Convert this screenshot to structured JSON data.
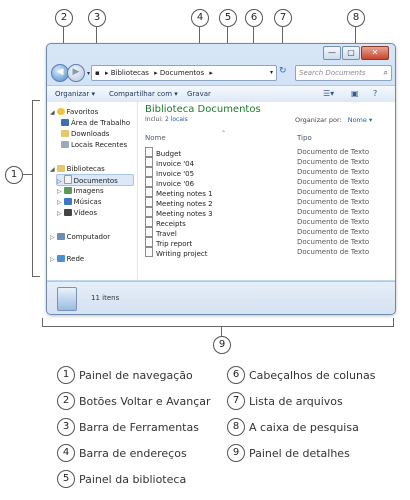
{
  "window": {
    "controls": {
      "minimize": "—",
      "maximize": "▢",
      "close": "✕"
    },
    "address": {
      "segments": [
        "▸ Bibliotecas",
        "▸ Documentos",
        "▸"
      ],
      "dropdown": "▾"
    },
    "search_placeholder": "Search Documents",
    "toolbar": {
      "organize": "Organizar ▾",
      "share": "Compartilhar com ▾",
      "burn": "Gravar"
    },
    "nav": {
      "favorites": "Favoritos",
      "desktop": "Área de Trabalho",
      "downloads": "Downloads",
      "recent": "Locais Recentes",
      "libraries": "Bibliotecas",
      "documents": "Documentos",
      "images": "Imagens",
      "music": "Músicas",
      "videos": "Vídeos",
      "computer": "Computador",
      "network": "Rede"
    },
    "library": {
      "title": "Biblioteca Documentos",
      "includes_label": "Inclui:",
      "includes_link": "2 locais",
      "arrange_label": "Organizar por:",
      "arrange_value": "Nome ▾"
    },
    "columns": {
      "name": "Nome",
      "type": "Tipo"
    },
    "files": [
      {
        "name": "Budget",
        "type": "Documento de Texto"
      },
      {
        "name": "Invoice '04",
        "type": "Documento de Texto"
      },
      {
        "name": "Invoice '05",
        "type": "Documento de Texto"
      },
      {
        "name": "Invoice '06",
        "type": "Documento de Texto"
      },
      {
        "name": "Meeting notes 1",
        "type": "Documento de Texto"
      },
      {
        "name": "Meeting notes 2",
        "type": "Documento de Texto"
      },
      {
        "name": "Meeting notes 3",
        "type": "Documento de Texto"
      },
      {
        "name": "Receipts",
        "type": "Documento de Texto"
      },
      {
        "name": "Travel",
        "type": "Documento de Texto"
      },
      {
        "name": "Trip report",
        "type": "Documento de Texto"
      },
      {
        "name": "Writing project",
        "type": "Documento de Texto"
      }
    ],
    "details": {
      "count": "11 itens"
    }
  },
  "callouts": {
    "c1": "1",
    "c2": "2",
    "c3": "3",
    "c4": "4",
    "c5": "5",
    "c6": "6",
    "c7": "7",
    "c8": "8",
    "c9": "9"
  },
  "legend": {
    "l1": "Painel de navegação",
    "l2": "Botões Voltar e Avançar",
    "l3": "Barra de Ferramentas",
    "l4": "Barra de endereços",
    "l5": "Painel da biblioteca",
    "l6": "Cabeçalhos de colunas",
    "l7": "Lista de arquivos",
    "l8": "A caixa de pesquisa",
    "l9": "Painel de detalhes"
  },
  "colors": {
    "library_title": "#1e7a2e",
    "link": "#1a5fb4",
    "frame": "#bcd3ec"
  }
}
